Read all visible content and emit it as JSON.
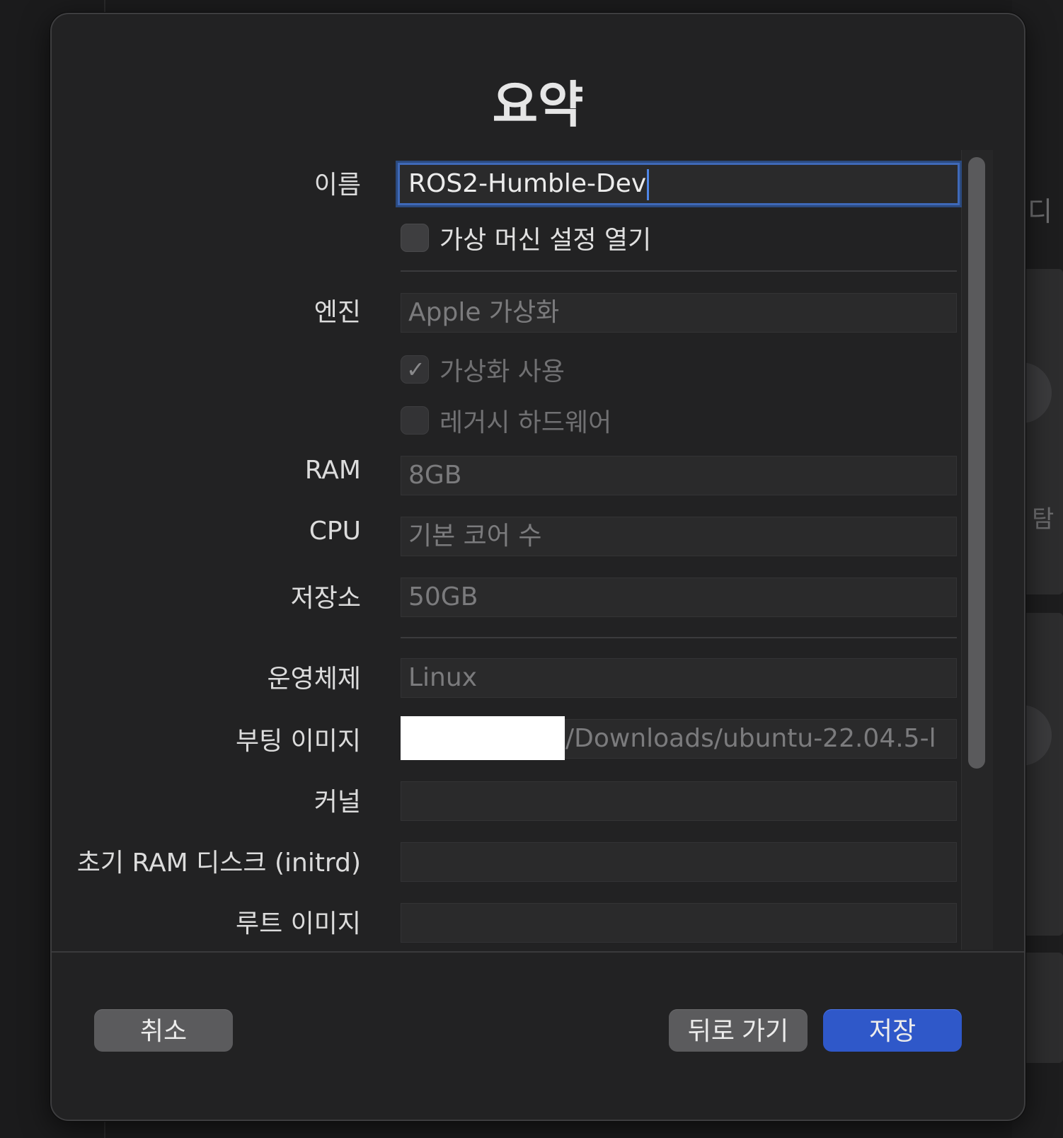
{
  "dialog": {
    "title": "요약"
  },
  "form": {
    "name_label": "이름",
    "name_value": "ROS2-Humble-Dev",
    "open_vm_settings_label": "가상 머신 설정 열기",
    "open_vm_settings_checked": false,
    "engine_label": "엔진",
    "engine_value": "Apple 가상화",
    "use_virtualization_label": "가상화 사용",
    "use_virtualization_checked": true,
    "legacy_hardware_label": "레거시 하드웨어",
    "legacy_hardware_checked": false,
    "ram_label": "RAM",
    "ram_value": "8GB",
    "cpu_label": "CPU",
    "cpu_value": "기본 코어 수",
    "storage_label": "저장소",
    "storage_value": "50GB",
    "os_label": "운영체제",
    "os_value": "Linux",
    "boot_image_label": "부팅 이미지",
    "boot_image_value": "/Downloads/ubuntu-22.04.5-l",
    "kernel_label": "커널",
    "kernel_value": "",
    "initrd_label": "초기 RAM 디스크 (initrd)",
    "initrd_value": "",
    "root_image_label": "루트 이미지"
  },
  "footer": {
    "cancel_label": "취소",
    "back_label": "뒤로 가기",
    "save_label": "저장"
  },
  "background": {
    "text_1": "디",
    "text_2": "탐"
  },
  "colors": {
    "accent": "#2f58c9",
    "focus_ring": "#3f69b8",
    "dialog_bg": "#222223"
  }
}
